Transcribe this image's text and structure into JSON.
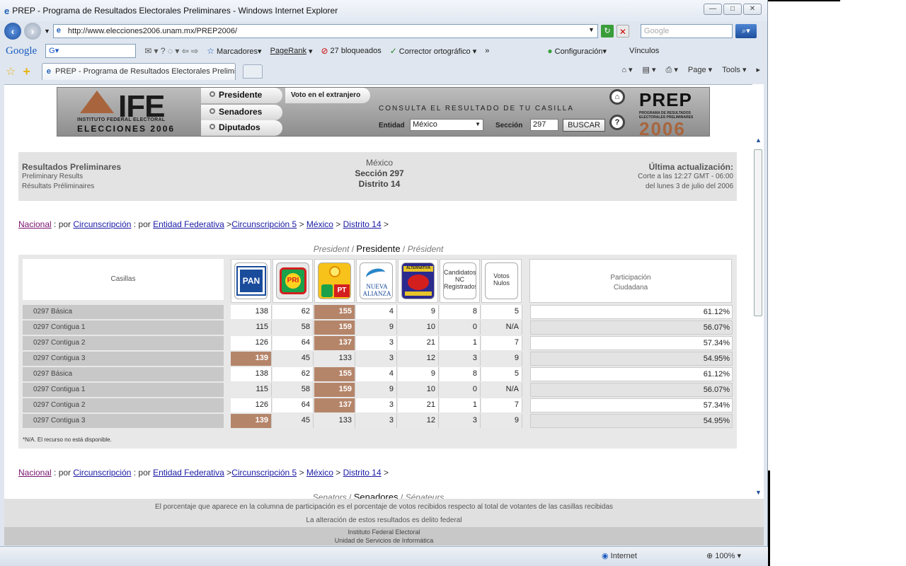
{
  "window": {
    "title": "PREP - Programa de Resultados Electorales Preliminares - Windows Internet Explorer",
    "controls": [
      "—",
      "□",
      "✕"
    ]
  },
  "addressbar": {
    "url": "http://www.elecciones2006.unam.mx/PREP2006/",
    "search_placeholder": "Google"
  },
  "google_toolbar": {
    "logo": "Google",
    "box_value": "G▾",
    "marcadores": "Marcadores▾",
    "pagerank": "PageRank",
    "bloqueados": "27 bloqueados",
    "corrector": "Corrector ortográfico ▾",
    "more": "»",
    "configuracion": "Configuración▾",
    "vinculos": "Vínculos"
  },
  "tabs": {
    "active_tab": "PREP - Programa de Resultados Electorales Preliminares"
  },
  "command_bar": {
    "page": "Page ▾",
    "tools": "Tools ▾"
  },
  "banner": {
    "ife_big": "IFE",
    "ife_sub1": "INSTITUTO FEDERAL ELECTORAL",
    "ife_sub2": "ELECCIONES 2006",
    "nav_presidente": "Presidente",
    "nav_senadores": "Senadores",
    "nav_diputados": "Diputados",
    "voto_extranjero": "Voto en el extranjero",
    "consulta": "CONSULTA EL RESULTADO DE TU CASILLA",
    "entidad_label": "Entidad",
    "entidad_value": "México",
    "seccion_label": "Sección",
    "seccion_value": "297",
    "buscar": "BUSCAR",
    "home_symbol": "⌂",
    "help_symbol": "?",
    "prep_title": "PREP",
    "prep_subtitle": "PROGRAMA DE RESULTADOS ELECTORALES PRELIMINARES",
    "prep_year": "2006"
  },
  "info": {
    "left_title": "Resultados Preliminares",
    "left_en": "Preliminary Results",
    "left_fr": "Résultats Préliminaires",
    "center_entity": "México",
    "center_section": "Sección 297",
    "center_district": "Distrito 14",
    "right_title": "Última actualización:",
    "right_line1": "Corte a las 12:27 GMT - 06:00",
    "right_line2": "del lunes 3 de julio del 2006"
  },
  "breadcrumb": {
    "nacional": "Nacional",
    "sep1": " : por ",
    "circunscripcion": "Circunscripción",
    "sep2": " : por ",
    "entidad_federativa": "Entidad Federativa",
    "sep3": " >",
    "circ5": "Circunscripción 5",
    "sep4": " > ",
    "mexico": "México",
    "sep5": " > ",
    "distrito": "Distrito 14",
    "sep6": " >"
  },
  "table_title": {
    "en": "President",
    "es": "Presidente",
    "fr": "Président",
    "slash": " / "
  },
  "senate_title": {
    "en": "Senators",
    "es": "Senadores",
    "fr": "Sénateurs",
    "slash": " / "
  },
  "results": {
    "casillas_header": "Casillas",
    "parties": [
      {
        "id": "pan",
        "text": "PAN"
      },
      {
        "id": "prd",
        "text": "PRI"
      },
      {
        "id": "pbt",
        "text": "PT"
      },
      {
        "id": "na",
        "text": "NUEVA ALIANZA"
      },
      {
        "id": "alt",
        "text": "ALTERNATIVA"
      },
      {
        "id": "nc",
        "text": "Candidatos NC Registrados"
      },
      {
        "id": "nulos",
        "text": "Votos Nulos"
      }
    ],
    "participacion_header_1": "Participación",
    "participacion_header_2": "Ciudadana",
    "rows": [
      {
        "casilla": "0297 Básica",
        "v": [
          "138",
          "62",
          "155",
          "4",
          "9",
          "8",
          "5"
        ],
        "win": 2,
        "part": "61.12%"
      },
      {
        "casilla": "0297 Contigua 1",
        "v": [
          "115",
          "58",
          "159",
          "9",
          "10",
          "0",
          "N/A"
        ],
        "win": 2,
        "part": "56.07%"
      },
      {
        "casilla": "0297 Contigua 2",
        "v": [
          "126",
          "64",
          "137",
          "3",
          "21",
          "1",
          "7"
        ],
        "win": 2,
        "part": "57.34%"
      },
      {
        "casilla": "0297 Contigua 3",
        "v": [
          "139",
          "45",
          "133",
          "3",
          "12",
          "3",
          "9"
        ],
        "win": 0,
        "part": "54.95%"
      },
      {
        "casilla": "0297 Básica",
        "v": [
          "138",
          "62",
          "155",
          "4",
          "9",
          "8",
          "5"
        ],
        "win": 2,
        "part": "61.12%"
      },
      {
        "casilla": "0297 Contigua 1",
        "v": [
          "115",
          "58",
          "159",
          "9",
          "10",
          "0",
          "N/A"
        ],
        "win": 2,
        "part": "56.07%"
      },
      {
        "casilla": "0297 Contigua 2",
        "v": [
          "126",
          "64",
          "137",
          "3",
          "21",
          "1",
          "7"
        ],
        "win": 2,
        "part": "57.34%"
      },
      {
        "casilla": "0297 Contigua 3",
        "v": [
          "139",
          "45",
          "133",
          "3",
          "12",
          "3",
          "9"
        ],
        "win": 0,
        "part": "54.95%"
      }
    ],
    "note": "*N/A. El recurso no está disponible."
  },
  "footer": {
    "line1": "El porcentaje que aparece en la columna de participación es el porcentaje de votos recibidos respecto al total de votantes de las casillas recibidas",
    "line2": "La alteración de estos resultados es delito federal",
    "line3": "Instituto Federal Electoral",
    "line4": "Unidad de Servicios de Informática"
  },
  "statusbar": {
    "zone": "Internet",
    "zoom": "100%"
  },
  "colors": {
    "winner_cell": "#b5856a",
    "ife_brown": "#a8653d"
  }
}
